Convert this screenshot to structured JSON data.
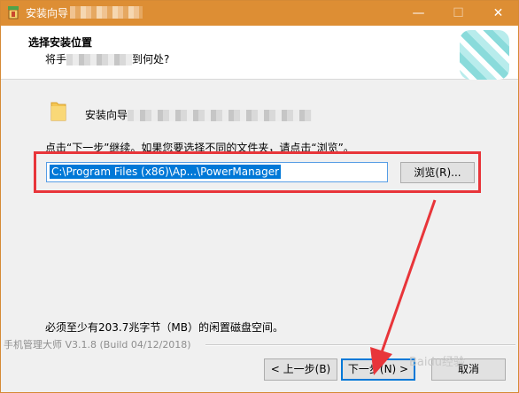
{
  "window": {
    "title": "安装向导",
    "minimize_glyph": "—",
    "maximize_glyph": "☐",
    "close_glyph": "✕",
    "accent_color": "#dd8e34"
  },
  "header": {
    "title": "选择安装位置",
    "subtitle_prefix": "将手",
    "subtitle_suffix": "到何处?"
  },
  "content": {
    "folder_label_prefix": "安装向导",
    "instruction": "点击“下一步”继续。如果您要选择不同的文件夹，请点击“浏览”。",
    "path_value": "C:\\Program Files (x86)\\Ap...\\PowerManager",
    "browse_label": "浏览(R)...",
    "space_required": "必须至少有203.7兆字节（MB）的闲置磁盘空间。"
  },
  "footer": {
    "brand": "手机管理大师 V3.1.8  (Build 04/12/2018)",
    "back_label": "< 上一步(B)",
    "next_label": "下一步(N) >",
    "cancel_label": "取消"
  },
  "icons": {
    "app": "installer-icon",
    "folder": "folder-icon",
    "logo": "app-logo"
  },
  "annotation_color": "#e8353a",
  "watermark": "Baidu经验"
}
